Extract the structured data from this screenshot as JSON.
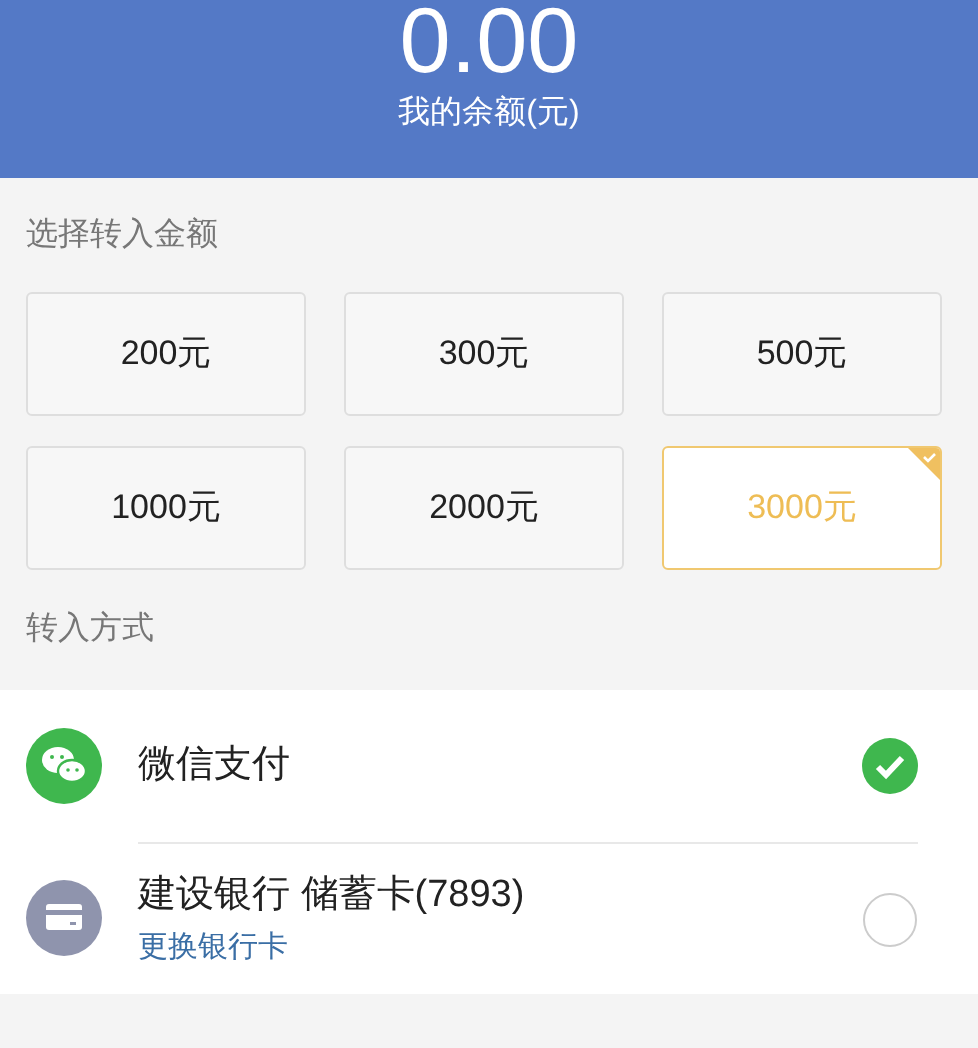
{
  "balance": {
    "amount": "0.00",
    "label": "我的余额(元)"
  },
  "amount_section": {
    "title": "选择转入金额",
    "options": [
      {
        "label": "200元",
        "selected": false
      },
      {
        "label": "300元",
        "selected": false
      },
      {
        "label": "500元",
        "selected": false
      },
      {
        "label": "1000元",
        "selected": false
      },
      {
        "label": "2000元",
        "selected": false
      },
      {
        "label": "3000元",
        "selected": true
      }
    ]
  },
  "method_section": {
    "title": "转入方式",
    "methods": [
      {
        "kind": "wechat",
        "name": "微信支付",
        "selected": true
      },
      {
        "kind": "bank",
        "name": "建设银行 储蓄卡(7893)",
        "link": "更换银行卡",
        "selected": false
      }
    ]
  }
}
